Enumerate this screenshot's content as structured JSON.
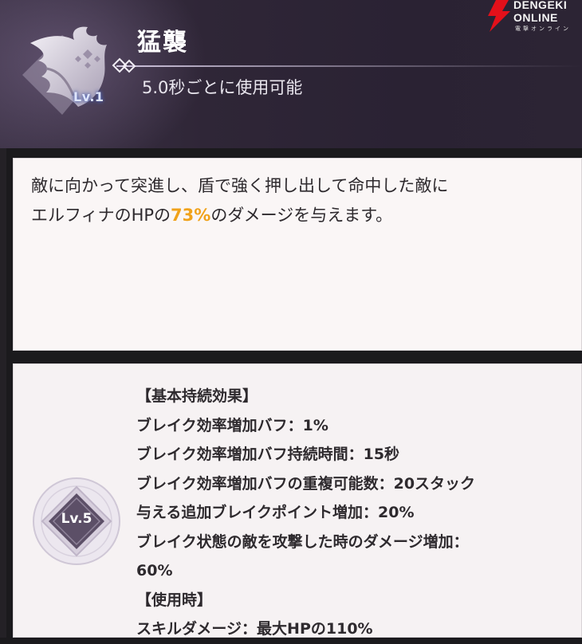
{
  "header": {
    "skill_name": "猛襲",
    "cooldown": "5.0秒ごとに使用可能",
    "level_badge": "Lv.1",
    "emblem_icon": "shield-rush-icon"
  },
  "watermark": {
    "line1": "DENGEKI",
    "line2": "ONLINE",
    "sub": "電撃オンライン",
    "icon": "lightning-bolt-icon",
    "color": "#e3101a"
  },
  "description": {
    "line1": "敵に向かって突進し、盾で強く押し出して命中した敵に",
    "line2_before": "エルフィナのHPの",
    "line2_value": "73%",
    "line2_after": "のダメージを与えます。",
    "accent_color": "#f0a21a"
  },
  "level_effect": {
    "badge": "Lv.5",
    "badge_icon": "level-diamond-icon",
    "lines": [
      "【基本持続効果】",
      "ブレイク効率増加バフ：1%",
      "ブレイク効率増加バフ持続時間：15秒",
      "ブレイク効率増加バフの重複可能数：20スタック",
      "与える追加ブレイクポイント増加：20%",
      "ブレイク状態の敵を攻撃した時のダメージ増加：",
      "60%",
      "【使用時】",
      "スキルダメージ：最大HPの110%"
    ]
  }
}
